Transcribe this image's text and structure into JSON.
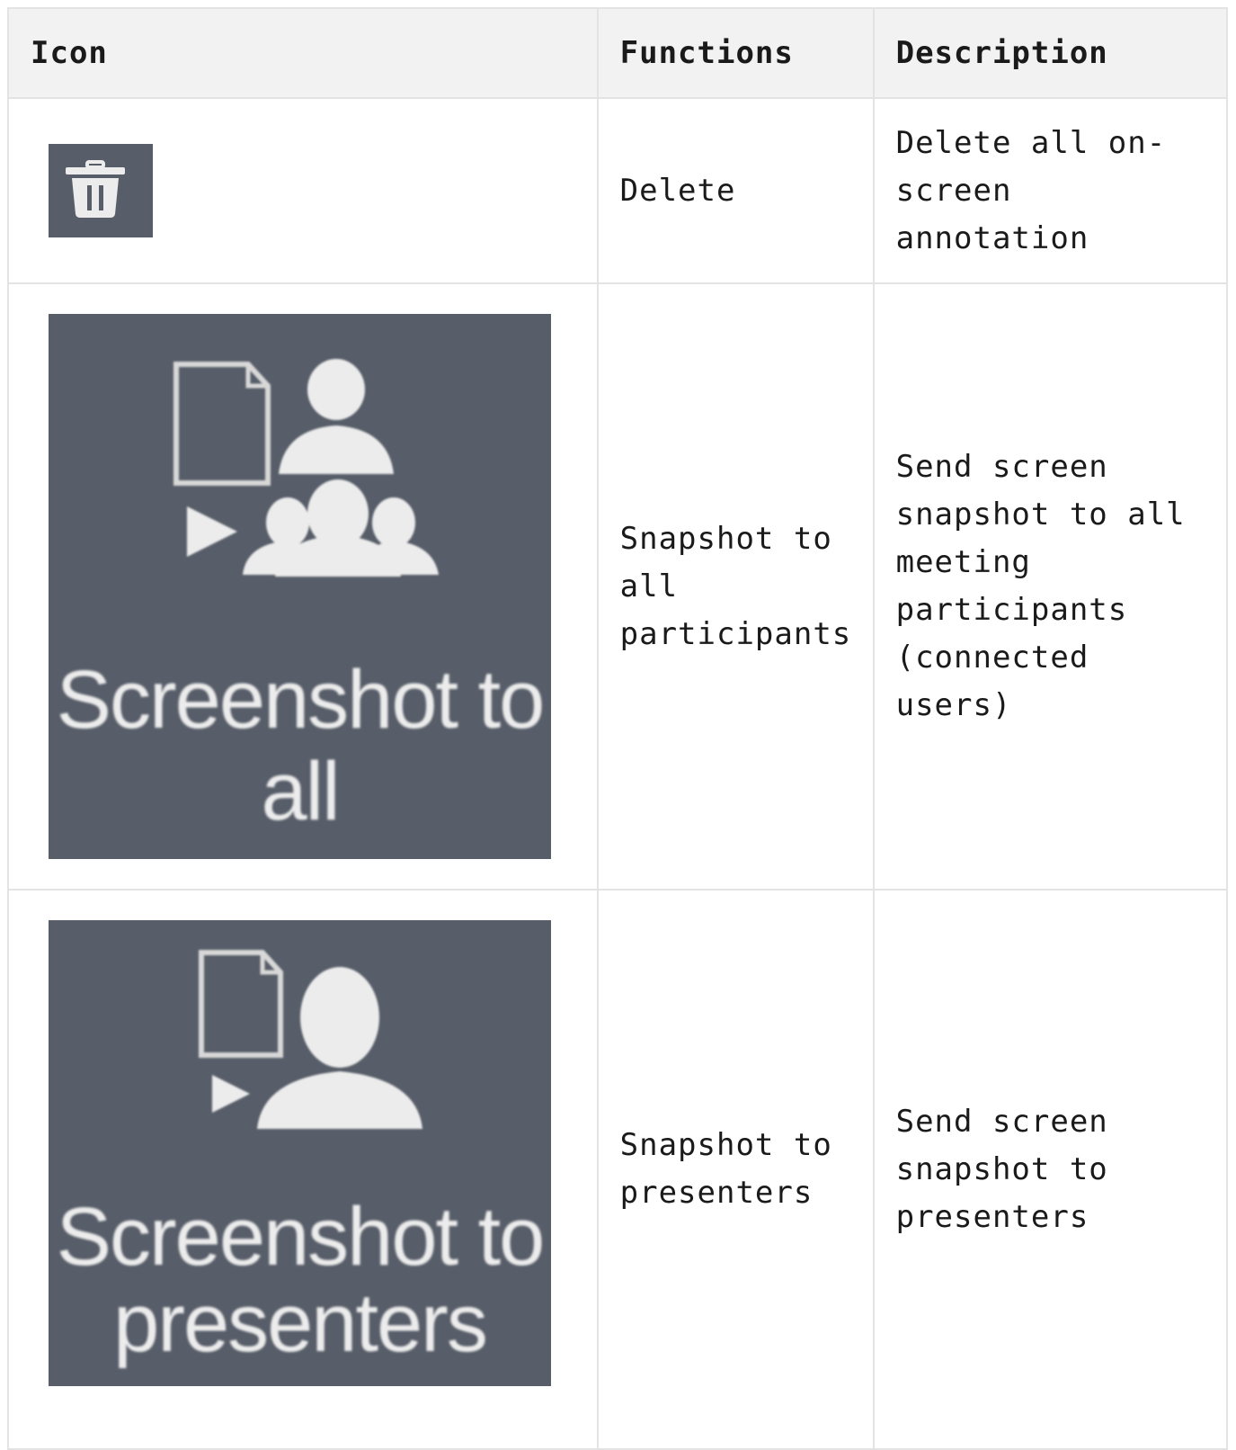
{
  "table": {
    "headers": [
      "Icon",
      "Functions",
      "Description"
    ],
    "rows": [
      {
        "icon_name": "trash-icon",
        "icon_label": "",
        "function": "Delete",
        "description": "Delete all on-screen annotation"
      },
      {
        "icon_name": "screenshot-to-all-icon",
        "icon_label": "Screenshot to all",
        "function": "Snapshot to all participants",
        "description": "Send screen snapshot to all meeting participants (connected users)"
      },
      {
        "icon_name": "screenshot-to-presenters-icon",
        "icon_label": "Screenshot to presenters",
        "function": "Snapshot to presenters",
        "description": "Send screen snapshot to presenters"
      }
    ]
  },
  "colors": {
    "icon_background": "#585e69",
    "icon_foreground": "#ececec",
    "header_background": "#f2f2f2",
    "border": "#e3e3e3"
  }
}
